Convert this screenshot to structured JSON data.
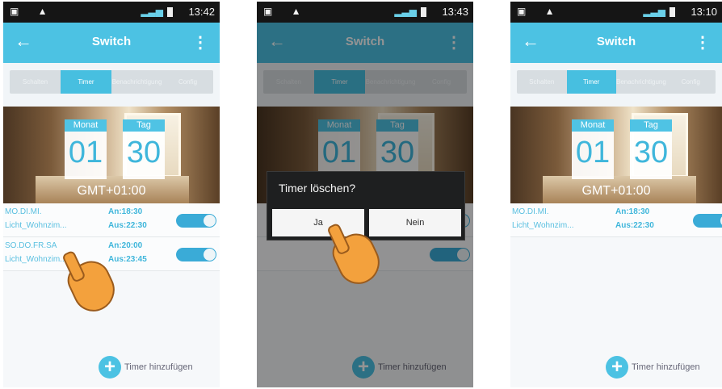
{
  "common": {
    "title": "Switch",
    "tabs": [
      "Schalten",
      "Timer",
      "Benachrichtigung",
      "Config"
    ],
    "active_tab": "Timer",
    "month_label": "Monat",
    "day_label": "Tag",
    "month_value": "01",
    "day_value": "30",
    "gmt": "GMT+01:00",
    "add_timer": "Timer hinzufügen",
    "icons": {
      "back": "arrow-left-icon",
      "menu": "more-vertical-icon",
      "add": "plus-circle-icon",
      "signal": "signal-icon",
      "battery": "battery-icon"
    },
    "colors": {
      "accent": "#4cc2e3",
      "accent_dark": "#3aabd7",
      "status_bar": "#151515",
      "hand": "#f3a13d"
    }
  },
  "screens": [
    {
      "time": "13:42",
      "timers": [
        {
          "days": "MO.DI.MI.",
          "name": "Licht_Wohnzim...",
          "on": "An:18:30",
          "off": "Aus:22:30"
        },
        {
          "days": "SO.DO.FR.SA",
          "name": "Licht_Wohnzim...",
          "on": "An:20:00",
          "off": "Aus:23:45"
        }
      ]
    },
    {
      "time": "13:43",
      "dialog": {
        "title": "Timer löschen?",
        "yes": "Ja",
        "no": "Nein"
      }
    },
    {
      "time": "13:10",
      "timers": [
        {
          "days": "MO.DI.MI.",
          "name": "Licht_Wohnzim...",
          "on": "An:18:30",
          "off": "Aus:22:30"
        }
      ]
    }
  ]
}
